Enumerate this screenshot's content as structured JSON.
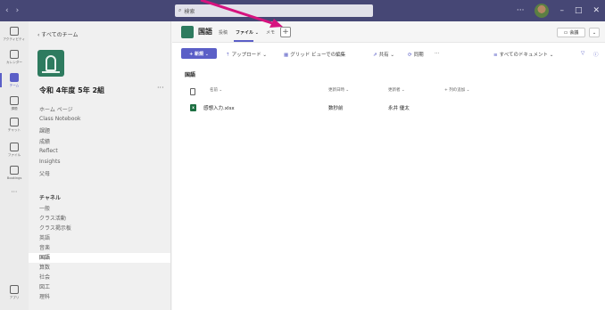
{
  "titlebar": {
    "back": "‹",
    "forward": "›",
    "search_placeholder": "検索",
    "more": "···",
    "minimize": "–",
    "maximize": "□",
    "close": "✕"
  },
  "rail": [
    {
      "label": "アクティビティ",
      "icon": "bell-icon"
    },
    {
      "label": "カレンダー",
      "icon": "calendar-icon"
    },
    {
      "label": "チーム",
      "icon": "teams-icon",
      "active": true
    },
    {
      "label": "課題",
      "icon": "assignments-icon"
    },
    {
      "label": "チャット",
      "icon": "chat-icon"
    },
    {
      "label": "ファイル",
      "icon": "files-icon"
    },
    {
      "label": "Bookings",
      "icon": "bookings-icon"
    },
    {
      "label": "···",
      "icon": "more-icon"
    },
    {
      "label": "アプリ",
      "icon": "apps-icon"
    }
  ],
  "sidebar": {
    "back_label": "‹ すべてのチーム",
    "team_name": "令和 4年度 5年 2組",
    "team_more": "···",
    "nav": [
      "ホーム ページ",
      "Class Notebook",
      "課題",
      "成績",
      "Reflect",
      "Insights",
      "父母"
    ],
    "channels_heading": "チャネル",
    "channels": [
      "一般",
      "クラス活動",
      "クラス掲示板",
      "英語",
      "音楽",
      "国語",
      "算数",
      "社会",
      "図工",
      "理科"
    ],
    "selected_channel": "国語"
  },
  "header": {
    "channel_title": "国語",
    "tabs": [
      "投稿",
      "ファイル ⌄",
      "メモ"
    ],
    "add_tab": "+",
    "meet_label": "会議",
    "meet_dropdown": "⌄"
  },
  "toolbar": {
    "new_label": "+ 新規 ⌄",
    "upload": "アップロード ⌄",
    "grid_edit": "グリッド ビューでの編集",
    "share": "共有 ⌄",
    "sync": "同期",
    "more": "···",
    "all_docs": "すべてのドキュメント ⌄",
    "filter_icon": "filter-icon",
    "info_icon": "info-icon"
  },
  "content": {
    "breadcrumb": "国語",
    "columns": [
      "名前 ⌄",
      "更新日時 ⌄",
      "更新者 ⌄",
      "+ 列の追加 ⌄"
    ],
    "files": [
      {
        "name": "感想入力.xlsx",
        "modified": "数秒前",
        "modified_by": "永井 優太"
      }
    ]
  },
  "colors": {
    "titlebar": "#464775",
    "accent": "#5b5fc7",
    "annotation": "#d6137f",
    "excel": "#1d6f42"
  }
}
